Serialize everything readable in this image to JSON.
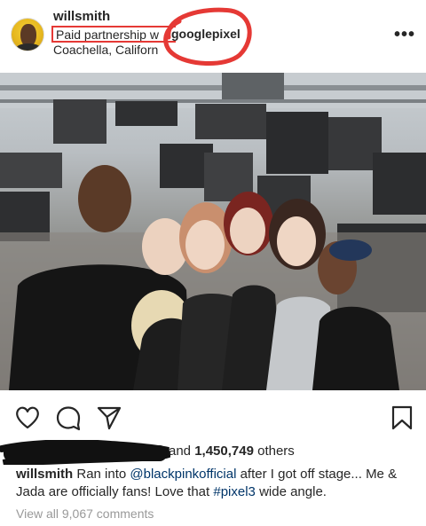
{
  "post": {
    "username": "willsmith",
    "partnership_label": "Paid partnership w",
    "partner": "googlepixel",
    "location": "Coachella, Californ",
    "likes_prefix": "and ",
    "likes_count": "1,450,749",
    "likes_suffix": " others",
    "caption_user": "willsmith",
    "caption_part1": " Ran into ",
    "caption_mention": "@blackpinkofficial",
    "caption_part2": " after I got off stage... Me & Jada are officially fans!  Love that ",
    "caption_hashtag": "#pixel3",
    "caption_part3": " wide angle.",
    "view_all": "View all 9,067 comments"
  },
  "icons": {
    "more": "more-options-icon",
    "like": "heart-icon",
    "comment": "comment-icon",
    "share": "share-icon",
    "save": "bookmark-icon"
  },
  "colors": {
    "annotation_red": "#e53935",
    "link": "#003569",
    "muted": "#999999"
  }
}
